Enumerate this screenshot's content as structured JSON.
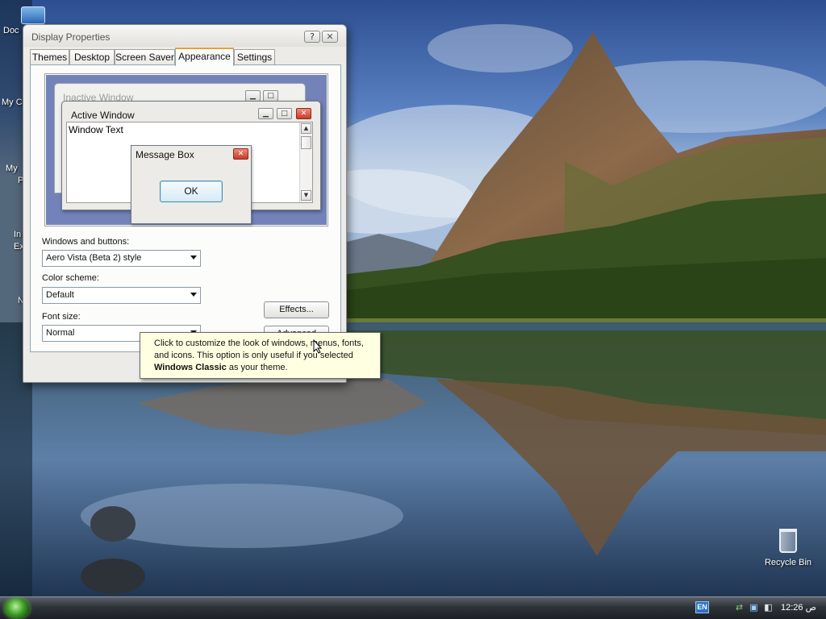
{
  "desktop": {
    "icons": {
      "documents": "Doc",
      "my_computer": "My C",
      "my_network_line1": "My",
      "my_network_line2": "P",
      "internet_explorer_line1": "In",
      "internet_explorer_line2": "Ex",
      "n_item": "N",
      "recycle_bin": "Recycle Bin"
    }
  },
  "window": {
    "title": "Display Properties",
    "help_label": "?",
    "close_label": "✕",
    "tabs": [
      "Themes",
      "Desktop",
      "Screen Saver",
      "Appearance",
      "Settings"
    ],
    "active_tab": "Appearance"
  },
  "preview": {
    "inactive_title": "Inactive Window",
    "active_title": "Active Window",
    "window_text": "Window Text",
    "message_box_title": "Message Box",
    "ok_label": "OK"
  },
  "form": {
    "windows_buttons_label": "Windows and buttons:",
    "windows_buttons_value": "Aero Vista (Beta 2) style",
    "color_scheme_label": "Color scheme:",
    "color_scheme_value": "Default",
    "font_size_label": "Font size:",
    "font_size_value": "Normal",
    "effects_label": "Effects...",
    "advanced_label": "Advanced"
  },
  "tooltip": {
    "text_part1": "Click to customize the look of windows, menus, fonts, and icons. This option is only useful if you selected ",
    "bold_part": "Windows Classic",
    "text_part2": " as your theme."
  },
  "taskbar": {
    "language": "EN",
    "clock": "ص 12:26"
  },
  "colors": {
    "preview_background": "#7383ba",
    "tooltip_background": "#ffffe1",
    "active_tab_accent": "#e0a238"
  },
  "icons": [
    "documents-icon",
    "recycle-bin-icon",
    "windows-start-orb",
    "network-tray-icon",
    "safely-remove-tray-icon",
    "display-tray-icon"
  ]
}
